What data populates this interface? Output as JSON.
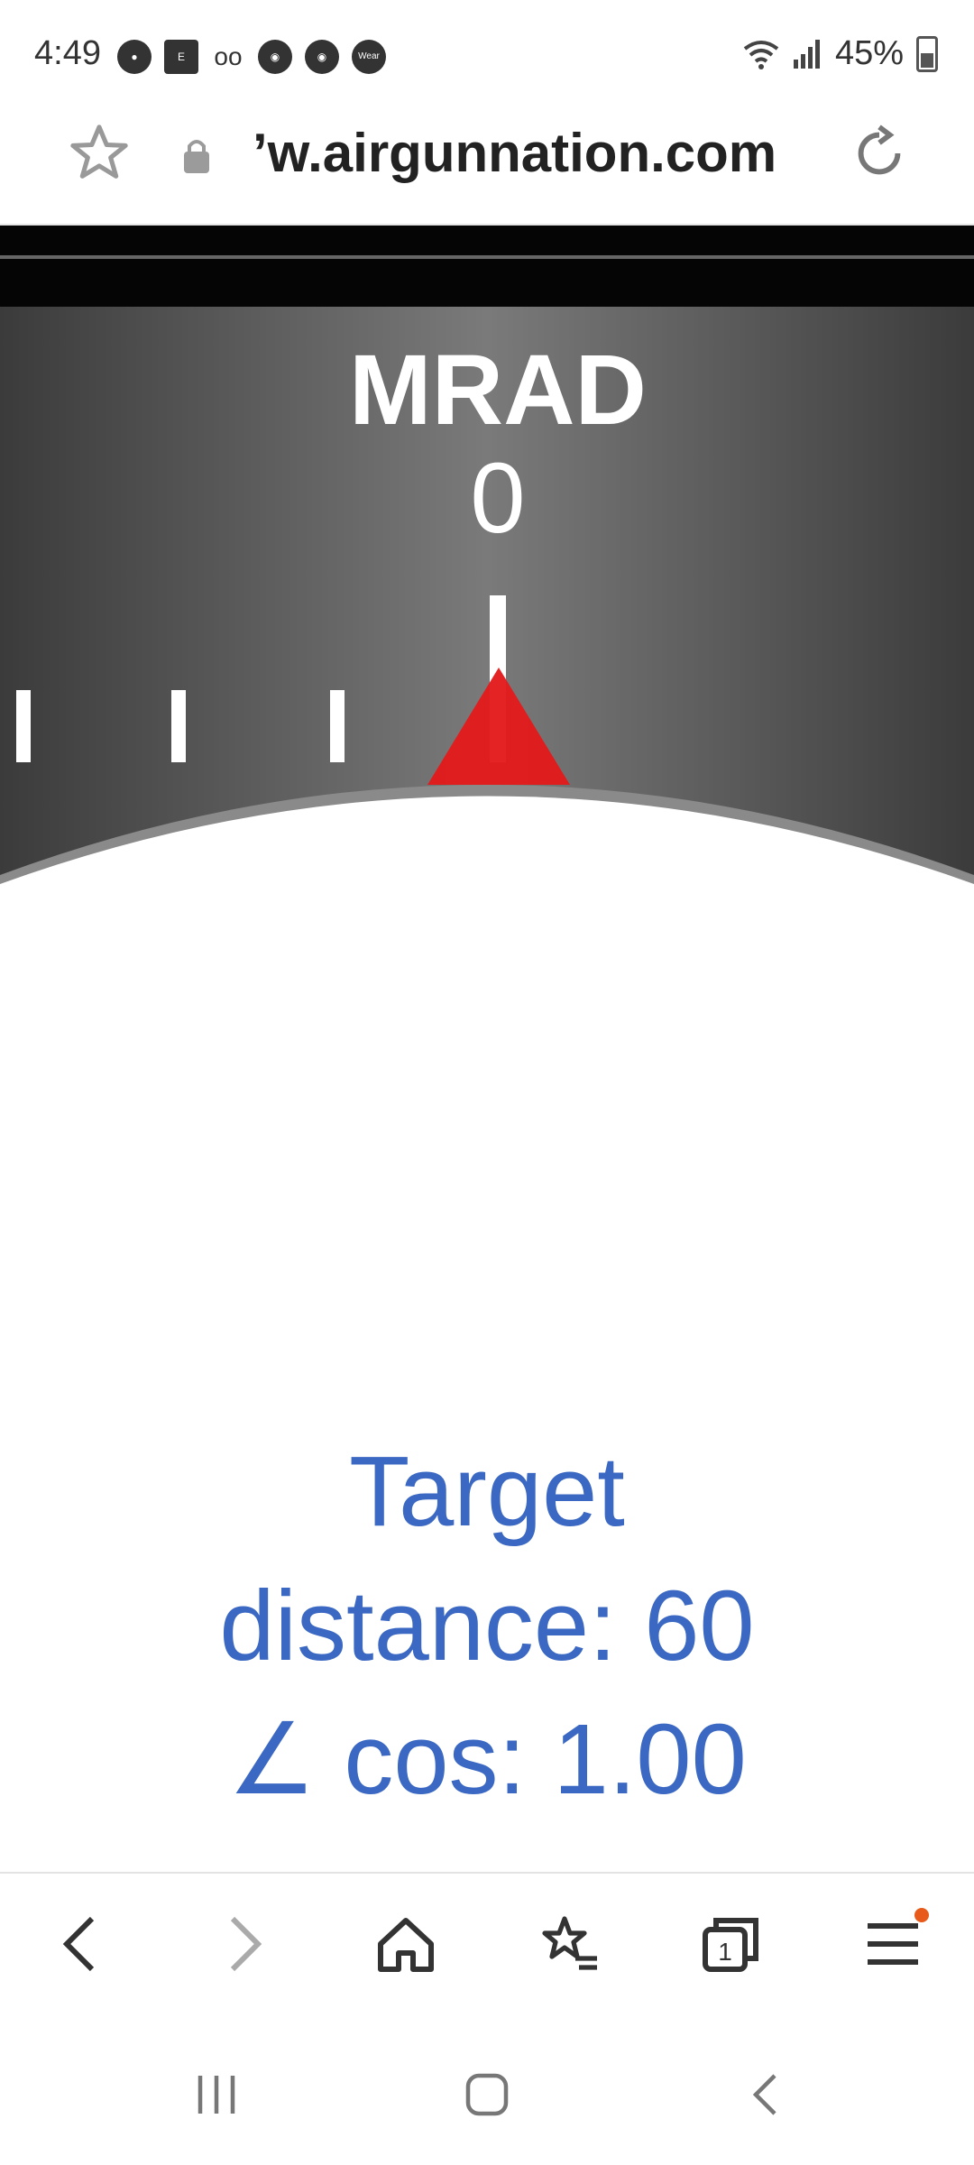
{
  "status_bar": {
    "time": "4:49",
    "battery": "45%",
    "notification_icons": [
      "chat-icon",
      "e-icon",
      "voicemail-icon",
      "chrome-icon",
      "chrome-icon",
      "wear-icon"
    ],
    "wear_label": "Wear"
  },
  "browser": {
    "url": "’w.airgunnation.com"
  },
  "scope": {
    "unit_label": "MRAD",
    "value": "0",
    "pointer_color": "#e31b1b",
    "background_color": "#4b4b4b"
  },
  "target": {
    "line1": "Target",
    "line2": "distance: 60",
    "line3": "∠ cos: 1.00",
    "text_color": "#3b68c2"
  },
  "bottom_nav": {
    "tabs_count": "1",
    "notification_dot_color": "#e85a1a"
  }
}
